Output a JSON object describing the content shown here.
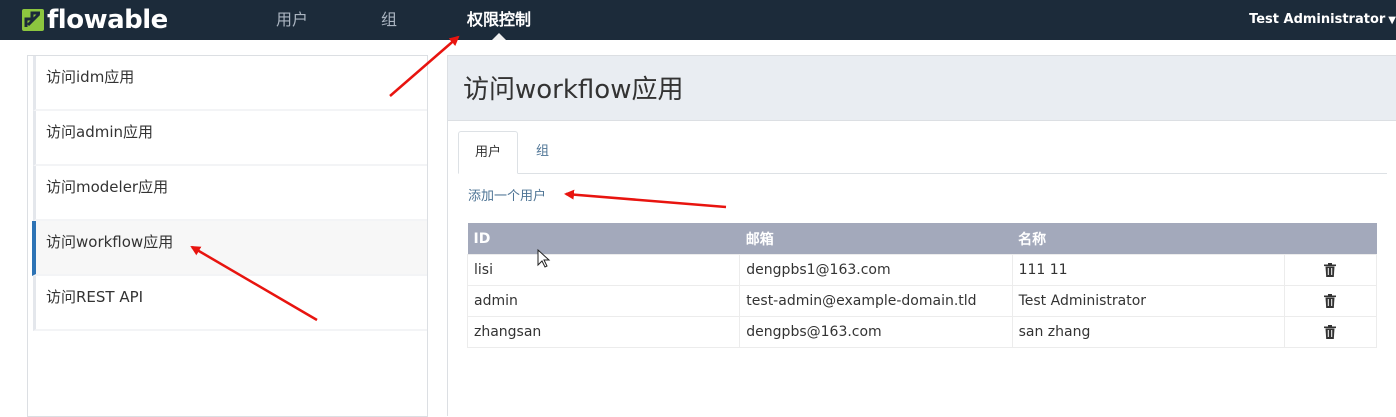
{
  "brand": {
    "name": "flowable"
  },
  "nav": {
    "items": [
      {
        "label": "用户"
      },
      {
        "label": "组"
      },
      {
        "label": "权限控制"
      }
    ],
    "user": "Test Administrator"
  },
  "sidebar": {
    "items": [
      {
        "label": "访问idm应用"
      },
      {
        "label": "访问admin应用"
      },
      {
        "label": "访问modeler应用"
      },
      {
        "label": "访问workflow应用"
      },
      {
        "label": "访问REST API"
      }
    ]
  },
  "main": {
    "title": "访问workflow应用",
    "tabs": [
      {
        "label": "用户"
      },
      {
        "label": "组"
      }
    ],
    "add_user": "添加一个用户",
    "table": {
      "columns": [
        "ID",
        "邮箱",
        "名称"
      ],
      "rows": [
        {
          "id": "lisi",
          "email": "dengpbs1@163.com",
          "name": "111 11"
        },
        {
          "id": "admin",
          "email": "test-admin@example-domain.tld",
          "name": "Test Administrator"
        },
        {
          "id": "zhangsan",
          "email": "dengpbs@163.com",
          "name": "san zhang"
        }
      ]
    }
  },
  "colors": {
    "topbar": "#1c2b3a",
    "brand_green": "#8cc63f",
    "link": "#4e7495",
    "table_header": "#a3a9bb",
    "active_indicator": "#2d73b5",
    "annotation_arrow": "#e8140f"
  },
  "icons": [
    "flowable-logo-icon",
    "chevron-down-icon",
    "trash-icon",
    "mouse-cursor-icon"
  ]
}
